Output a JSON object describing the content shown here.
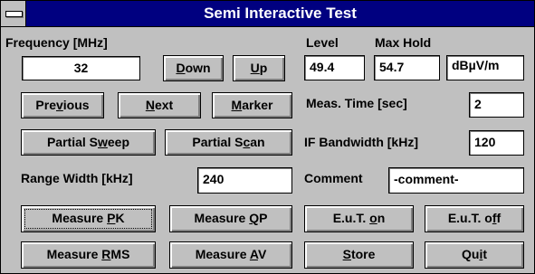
{
  "window": {
    "title": "Semi Interactive Test"
  },
  "labels": {
    "frequency": "Frequency [MHz]",
    "level": "Level",
    "max_hold": "Max Hold",
    "meas_time": "Meas. Time [sec]",
    "if_bandwidth": "IF Bandwidth [kHz]",
    "range_width": "Range Width [kHz]",
    "comment": "Comment"
  },
  "fields": {
    "frequency": "32",
    "level": "49.4",
    "max_hold": "54.7",
    "unit": "dBµV/m",
    "meas_time": "2",
    "if_bandwidth": "120",
    "range_width": "240",
    "comment": "-comment-"
  },
  "buttons": {
    "down": {
      "pre": "",
      "key": "D",
      "post": "own"
    },
    "up": {
      "pre": "",
      "key": "U",
      "post": "p"
    },
    "previous": {
      "pre": "Pre",
      "key": "v",
      "post": "ious"
    },
    "next": {
      "pre": "",
      "key": "N",
      "post": "ext"
    },
    "marker": {
      "pre": "",
      "key": "M",
      "post": "arker"
    },
    "partial_sweep": {
      "pre": "Partial S",
      "key": "w",
      "post": "eep"
    },
    "partial_scan": {
      "pre": "Partial S",
      "key": "c",
      "post": "an"
    },
    "measure_pk": {
      "pre": "Measure ",
      "key": "P",
      "post": "K"
    },
    "measure_qp": {
      "pre": "Measure ",
      "key": "Q",
      "post": "P"
    },
    "eut_on": {
      "pre": "E.u.T. ",
      "key": "o",
      "post": "n"
    },
    "eut_off": {
      "pre": "E.u.T. o",
      "key": "f",
      "post": "f"
    },
    "measure_rms": {
      "pre": "Measure ",
      "key": "R",
      "post": "MS"
    },
    "measure_av": {
      "pre": "Measure ",
      "key": "A",
      "post": "V"
    },
    "store": {
      "pre": "",
      "key": "S",
      "post": "tore"
    },
    "quit": {
      "pre": "Qu",
      "key": "i",
      "post": "t"
    }
  }
}
